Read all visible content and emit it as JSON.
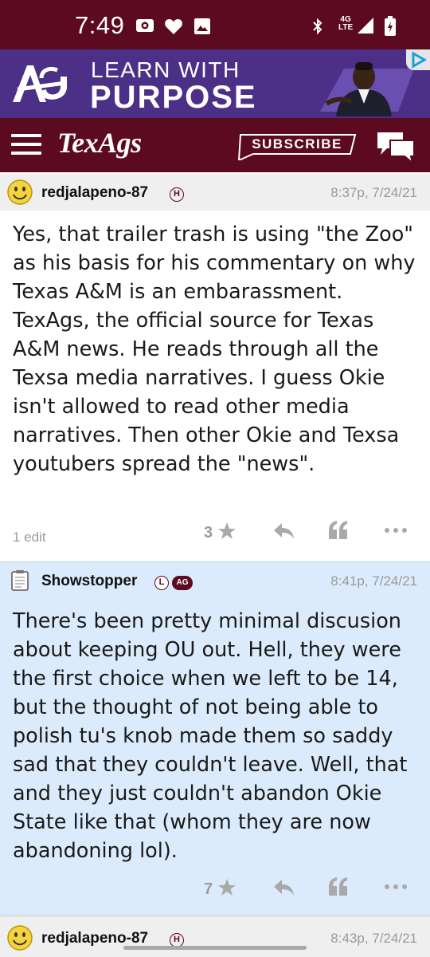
{
  "status_bar": {
    "time": "7:49",
    "network": "4G",
    "network_sub": "LTE"
  },
  "ad": {
    "line1": "LEARN WITH",
    "line2": "PURPOSE",
    "colors": {
      "background": "#4c2f86"
    }
  },
  "navbar": {
    "brand": "TexAgs",
    "subscribe_label": "SUBSCRIBE",
    "colors": {
      "background": "#5b0a1f"
    }
  },
  "posts": [
    {
      "username": "redjalapeno-87",
      "badges": [
        "H"
      ],
      "timestamp": "8:37p, 7/24/21",
      "body": "Yes, that trailer trash is using \"the Zoo\" as his basis for his commentary on why Texas A&M is an embarassment. TexAgs, the official source for Texas A&M news. He reads through all the Texsa media narratives. I guess Okie isn't allowed to read other media narratives. Then other Okie and Texsa youtubers spread the \"news\".",
      "edit_note": "1 edit",
      "stars": "3",
      "avatar_icon": "smiley-avatar-icon"
    },
    {
      "username": "Showstopper",
      "badges": [
        "L",
        "AG"
      ],
      "timestamp": "8:41p, 7/24/21",
      "body": "There's been pretty minimal discusion about keeping OU out. Hell, they were the first choice when we left to be 14, but the thought of not being able to polish tu's knob made them so saddy sad that they couldn't leave. Well, that and they just couldn't abandon Okie State like that (whom they are now abandoning lol).",
      "edit_note": "",
      "stars": "7",
      "avatar_icon": "notepad-avatar-icon"
    },
    {
      "username": "redjalapeno-87",
      "badges": [
        "H"
      ],
      "timestamp": "8:43p, 7/24/21",
      "avatar_icon": "smiley-avatar-icon"
    }
  ],
  "colors": {
    "maroon": "#5b0a1f",
    "highlight_post": "#dcebfb",
    "meta_gray": "#9a9a9a"
  }
}
